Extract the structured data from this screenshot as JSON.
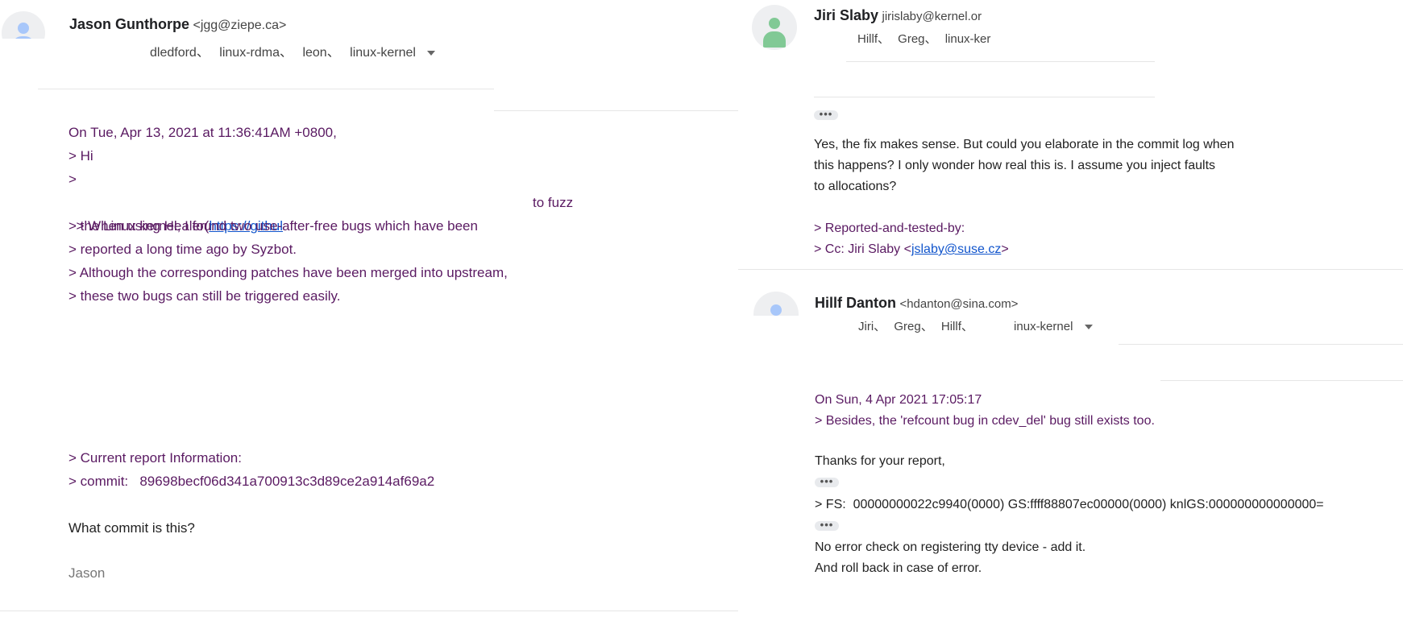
{
  "left": {
    "sender": {
      "name": "Jason Gunthorpe",
      "email": "<jgg@ziepe.ca>"
    },
    "recipients": [
      "dledford、",
      "linux-rdma、",
      "leon、",
      "linux-kernel"
    ],
    "quote_lines": [
      "On Tue, Apr 13, 2021 at 11:36:41AM +0800,",
      "> Hi",
      ">"
    ],
    "healer_line": {
      "prefix": "> When using Healer(",
      "link": "https://githul",
      "suffix": "to fuzz"
    },
    "quote_lines_2": [
      "> the Linux kernel, I found two use-after-free bugs which have been",
      "> reported a long time ago by Syzbot.",
      "> Although the corresponding patches have been merged into upstream,",
      "> these two bugs can still be triggered easily."
    ],
    "report_lines": [
      "> Current report Information:",
      "> commit:   89698becf06d341a700913c3d89ce2a914af69a2"
    ],
    "reply": "What commit is this?",
    "signature": "Jason"
  },
  "right_top": {
    "sender": {
      "name": "Jiri Slaby",
      "email": "jirislaby@kernel.or"
    },
    "recipients": [
      "Hillf、",
      "Greg、",
      "linux-ker"
    ],
    "more": "•••",
    "reply_lines": [
      "Yes, the fix makes sense. But could you elaborate in the commit log when",
      "this happens? I only wonder how real this is. I assume you inject faults",
      "to allocations?"
    ],
    "quote_lines": [
      "> Reported-and-tested-by:"
    ],
    "cc_line": {
      "prefix": "> Cc: Jiri Slaby <",
      "link": "jslaby@suse.cz",
      "suffix": ">"
    }
  },
  "right_bottom": {
    "sender": {
      "name": "Hillf Danton",
      "email": "<hdanton@sina.com>"
    },
    "recipients": [
      "Jiri、",
      "Greg、",
      "Hillf、",
      "inux-kernel"
    ],
    "quote_lines": [
      "On Sun, 4 Apr 2021 17:05:17",
      "> Besides, the 'refcount bug in cdev_del' bug still exists too."
    ],
    "thanks": "Thanks for your report,",
    "more1": "•••",
    "fs_line": "> FS:  00000000022c9940(0000) GS:ffff88807ec00000(0000) knlGS:000000000000000=",
    "more2": "•••",
    "closing": [
      "No error check on registering tty device - add it.",
      "And roll back in case of error."
    ]
  },
  "colors": {
    "quote": "#5a1a62",
    "link": "#1155cc",
    "avatar_left": "#a8c7fa",
    "avatar_jiri": "#81c995",
    "avatar_hillf": "#a8c7fa"
  }
}
